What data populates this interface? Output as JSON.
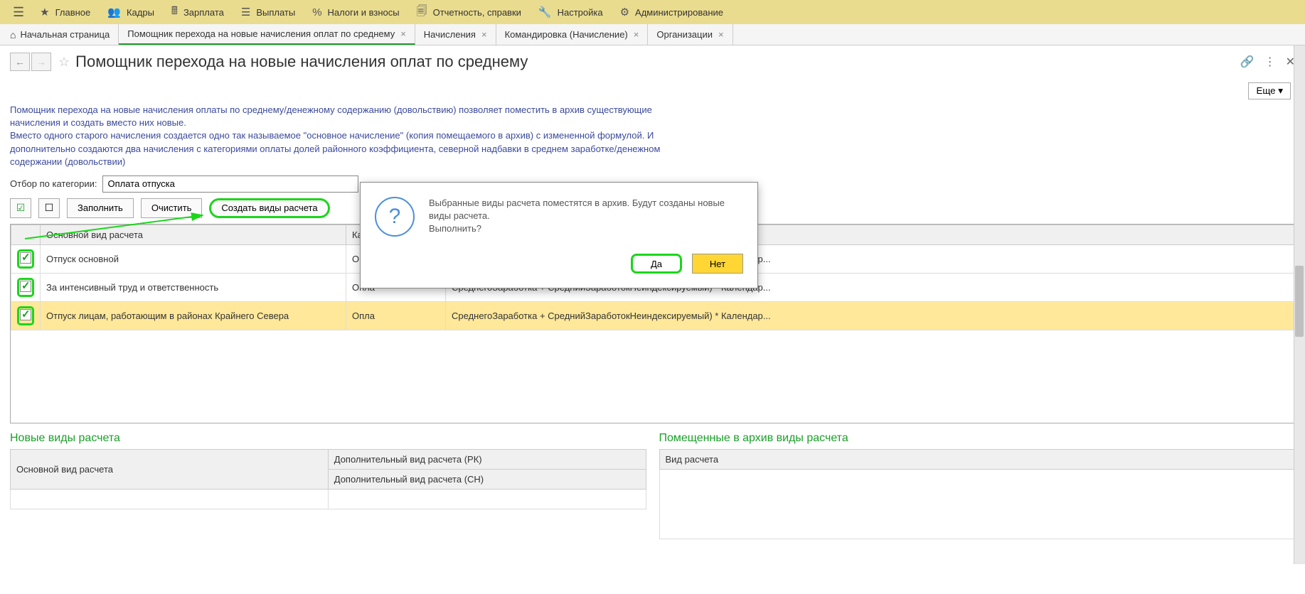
{
  "topMenu": [
    {
      "label": "Главное"
    },
    {
      "label": "Кадры"
    },
    {
      "label": "Зарплата"
    },
    {
      "label": "Выплаты"
    },
    {
      "label": "Налоги и взносы"
    },
    {
      "label": "Отчетность, справки"
    },
    {
      "label": "Настройка"
    },
    {
      "label": "Администрирование"
    }
  ],
  "tabs": {
    "home": "Начальная страница",
    "list": [
      {
        "label": "Помощник перехода на новые начисления оплат по среднему",
        "active": true
      },
      {
        "label": "Начисления"
      },
      {
        "label": "Командировка (Начисление)"
      },
      {
        "label": "Организации"
      }
    ]
  },
  "pageTitle": "Помощник перехода на новые начисления оплат по среднему",
  "moreLabel": "Еще",
  "infoText": "Помощник перехода на новые начисления оплаты по среднему/денежному содержанию (довольствию) позволяет поместить в архив существующие начисления и создать вместо них новые.\nВместо одного старого начисления создается одно так называемое \"основное начисление\" (копия помещаемого в архив) с измененной формулой. И дополнительно создаются два начисления с категориями оплаты долей районного коэффициента, северной надбавки в среднем заработке/денежном содержании (довольствии)",
  "filter": {
    "label": "Отбор по категории:",
    "value": "Оплата отпуска"
  },
  "actions": {
    "fill": "Заполнить",
    "clear": "Очистить",
    "create": "Создать виды расчета"
  },
  "mainTable": {
    "headers": {
      "main": "Основной вид расчета",
      "category": "Кате",
      "formula": ""
    },
    "rows": [
      {
        "checked": true,
        "main": "Отпуск основной",
        "category": "Опла",
        "formula": "СреднегоЗаработка + СреднийЗаработокНеиндексируемый) * Календар..."
      },
      {
        "checked": true,
        "main": "За интенсивный труд и ответственность",
        "category": "Опла",
        "formula": "СреднегоЗаработка + СреднийЗаработокНеиндексируемый) * Календар..."
      },
      {
        "checked": true,
        "main": "Отпуск лицам, работающим в районах Крайнего Севера",
        "category": "Опла",
        "formula": "СреднегоЗаработка + СреднийЗаработокНеиндексируемый) * Календар...",
        "selected": true
      }
    ]
  },
  "bottom": {
    "leftTitle": "Новые виды расчета",
    "leftHeaders": {
      "main": "Основной вид расчета",
      "rk": "Дополнительный вид расчета (РК)",
      "sn": "Дополнительный вид расчета (СН)"
    },
    "rightTitle": "Помещенные в архив виды расчета",
    "rightHeader": "Вид расчета"
  },
  "dialog": {
    "line1": "Выбранные виды расчета поместятся в архив. Будут созданы новые виды расчета.",
    "line2": "Выполнить?",
    "yes": "Да",
    "no": "Нет"
  }
}
